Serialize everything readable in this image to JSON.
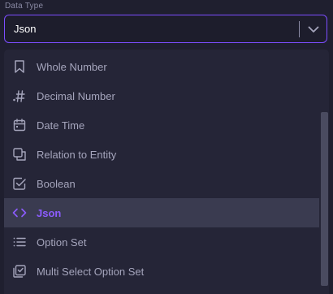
{
  "field": {
    "label": "Data Type",
    "selected_value": "Json"
  },
  "menu": {
    "items": [
      {
        "label": "Whole Number",
        "icon": "bookmark-icon",
        "selected": false
      },
      {
        "label": "Decimal Number",
        "icon": "decimal-hash-icon",
        "selected": false
      },
      {
        "label": "Date Time",
        "icon": "calendar-icon",
        "selected": false
      },
      {
        "label": "Relation to Entity",
        "icon": "relation-icon",
        "selected": false
      },
      {
        "label": "Boolean",
        "icon": "checkbox-icon",
        "selected": false
      },
      {
        "label": "Json",
        "icon": "code-brackets-icon",
        "selected": true
      },
      {
        "label": "Option Set",
        "icon": "list-icon",
        "selected": false
      },
      {
        "label": "Multi Select Option Set",
        "icon": "multi-select-icon",
        "selected": false
      }
    ]
  },
  "colors": {
    "background": "#1f1f2f",
    "menu_background": "#252537",
    "accent": "#7c4dff",
    "selected_row": "#3a3b50",
    "text": "#a5a5bc",
    "selected_text": "#8c5cff"
  }
}
